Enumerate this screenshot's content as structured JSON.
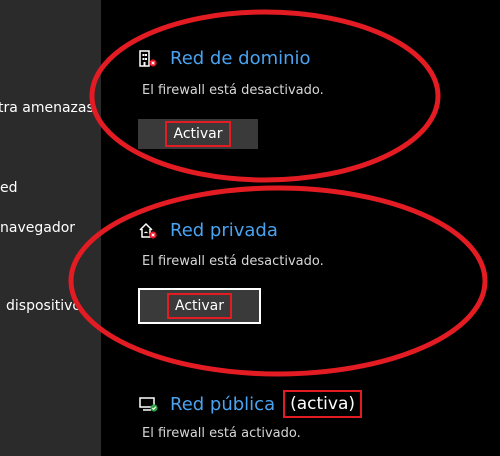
{
  "sidebar": {
    "items": [
      {
        "label": "tra amenazas"
      },
      {
        "label": "ed"
      },
      {
        "label": "navegador"
      },
      {
        "label": "dispositivo"
      }
    ]
  },
  "networks": {
    "domain": {
      "icon": "domain-network-icon",
      "name": "Red de dominio",
      "status": "El firewall está desactivado.",
      "button": "Activar"
    },
    "private": {
      "icon": "private-network-icon",
      "name": "Red privada",
      "status": "El firewall está desactivado.",
      "button": "Activar"
    },
    "public": {
      "icon": "public-network-icon",
      "name": "Red pública",
      "active_tag": "(activa)",
      "status": "El firewall está activado."
    }
  },
  "colors": {
    "link_blue": "#4aa3f0",
    "annotation_red": "#e31b23",
    "sidebar_bg": "#2b2b2b",
    "button_bg": "#3a3a3a",
    "status_green": "#2ea043",
    "status_red": "#e81123"
  }
}
